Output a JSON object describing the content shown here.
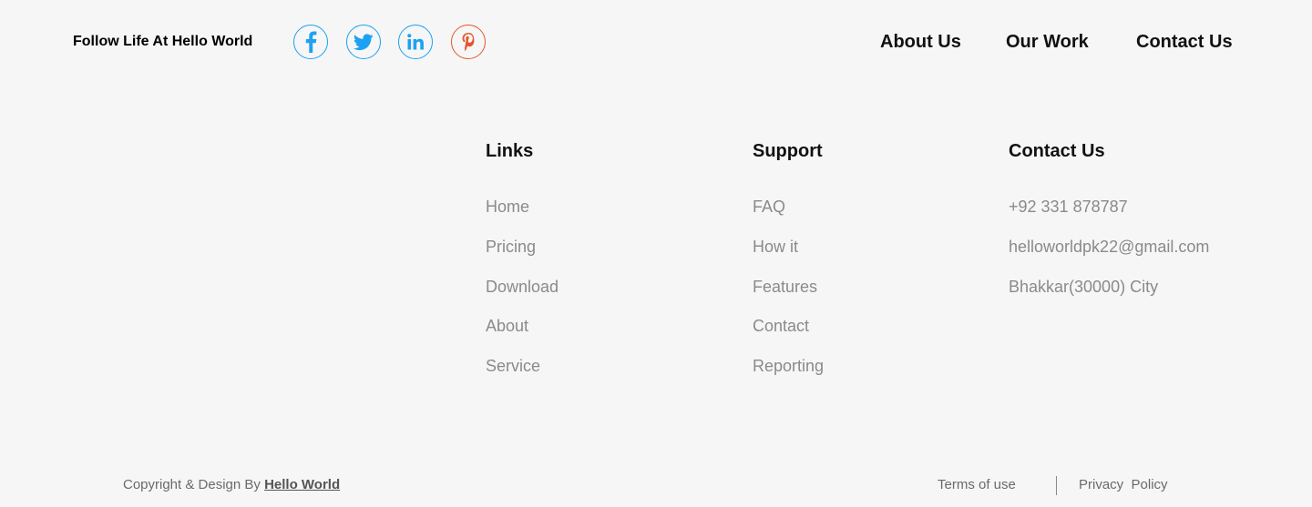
{
  "follow": {
    "text": "Follow Life At Hello World"
  },
  "social": [
    {
      "icon": "facebook-icon",
      "color": "#1da1f2"
    },
    {
      "icon": "twitter-icon",
      "color": "#1da1f2"
    },
    {
      "icon": "linkedin-icon",
      "color": "#1da1f2"
    },
    {
      "icon": "pinterest-icon",
      "color": "#e4572e"
    }
  ],
  "nav": {
    "about": "About Us",
    "work": "Our Work",
    "contact": "Contact Us"
  },
  "links": {
    "title": "Links",
    "items": [
      "Home",
      "Pricing",
      "Download",
      "About",
      "Service"
    ]
  },
  "support": {
    "title": "Support",
    "items": [
      "FAQ",
      "How it",
      "Features",
      "Contact",
      "Reporting"
    ]
  },
  "contact": {
    "title": "Contact Us",
    "phone": "+92 331 878787",
    "email": "helloworldpk22@gmail.com",
    "address": "Bhakkar(30000) City"
  },
  "footer": {
    "copyright_prefix": "Copyright & Design By ",
    "brand": "Hello World",
    "terms": "Terms of use",
    "privacy": "Privacy  Policy"
  }
}
